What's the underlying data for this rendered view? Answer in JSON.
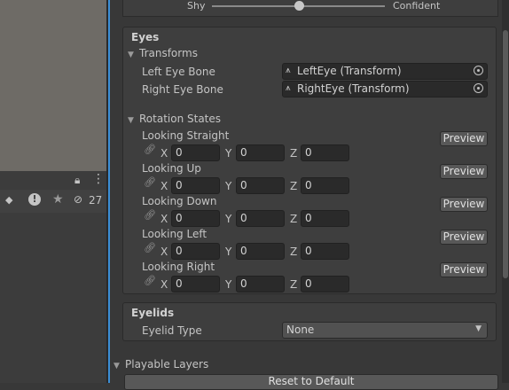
{
  "personality_slider": {
    "min_label": "Shy",
    "max_label": "Confident",
    "value": 0.5
  },
  "eyes": {
    "title": "Eyes",
    "transforms": {
      "title": "Transforms",
      "left_eye": {
        "label": "Left Eye Bone",
        "value": "LeftEye (Transform)"
      },
      "right_eye": {
        "label": "Right Eye Bone",
        "value": "RightEye (Transform)"
      }
    },
    "rotation_states": {
      "title": "Rotation States",
      "preview_label": "Preview",
      "axis_labels": [
        "X",
        "Y",
        "Z"
      ],
      "states": [
        {
          "label": "Looking Straight",
          "x": "0",
          "y": "0",
          "z": "0"
        },
        {
          "label": "Looking Up",
          "x": "0",
          "y": "0",
          "z": "0"
        },
        {
          "label": "Looking Down",
          "x": "0",
          "y": "0",
          "z": "0"
        },
        {
          "label": "Looking Left",
          "x": "0",
          "y": "0",
          "z": "0"
        },
        {
          "label": "Looking Right",
          "x": "0",
          "y": "0",
          "z": "0"
        }
      ]
    }
  },
  "eyelids": {
    "title": "Eyelids",
    "type_label": "Eyelid Type",
    "type_value": "None"
  },
  "playable_layers": {
    "title": "Playable Layers",
    "reset_label": "Reset to Default"
  },
  "toolbar": {
    "hidden_count": "27"
  },
  "colors": {
    "accent": "#3b8ed6",
    "panel": "#3e3e3e",
    "field": "#2a2a2a"
  }
}
